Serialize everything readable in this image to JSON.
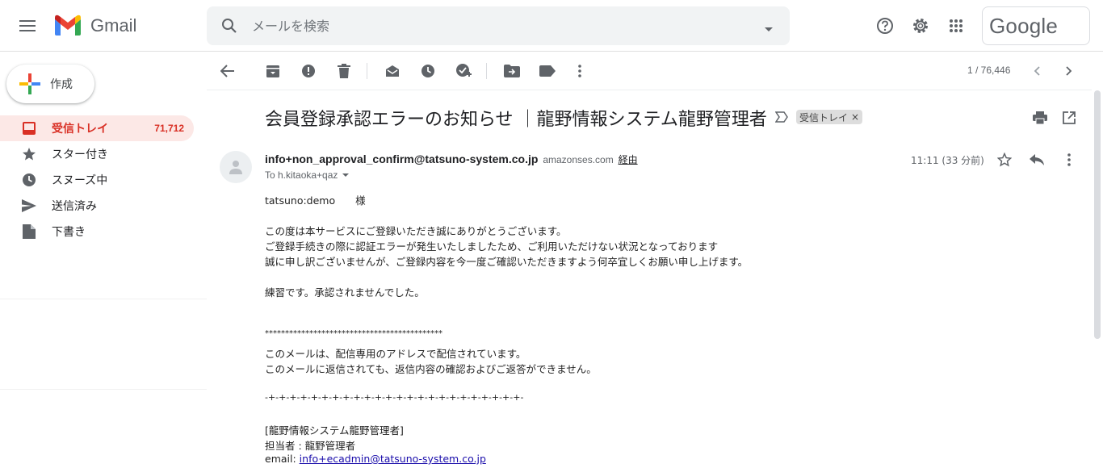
{
  "header": {
    "app_name": "Gmail",
    "search_placeholder": "メールを検索",
    "account_brand": "Google"
  },
  "sidebar": {
    "compose_label": "作成",
    "items": [
      {
        "label": "受信トレイ",
        "count": "71,712",
        "icon": "inbox-icon",
        "active": true
      },
      {
        "label": "スター付き",
        "count": "",
        "icon": "star-icon",
        "active": false
      },
      {
        "label": "スヌーズ中",
        "count": "",
        "icon": "clock-icon",
        "active": false
      },
      {
        "label": "送信済み",
        "count": "",
        "icon": "send-icon",
        "active": false
      },
      {
        "label": "下書き",
        "count": "",
        "icon": "draft-icon",
        "active": false
      }
    ]
  },
  "toolbar": {
    "pager": "1 / 76,446"
  },
  "message": {
    "subject": "会員登録承認エラーのお知らせ ｜龍野情報システム龍野管理者",
    "label_chip": "受信トレイ",
    "chip_close": "×",
    "sender_email": "info+non_approval_confirm@tatsuno-system.co.jp",
    "via_domain": "amazonses.com",
    "via_label": "経由",
    "to": "To h.kitaoka+qaz",
    "time": "11:11 (33 分前)",
    "body_lines": [
      "tatsuno:demo　　様",
      "この度は本サービスにご登録いただき誠にありがとうございます。",
      "ご登録手続きの際に認証エラーが発生いたしましたため、ご利用いただけない状況となっております",
      "誠に申し訳ございませんが、ご登録内容を今一度ご確認いただきますよう何卒宜しくお願い申し上げます。",
      "練習です。承認されませんでした。",
      "********************************************",
      "このメールは、配信専用のアドレスで配信されています。",
      "このメールに返信されても、返信内容の確認およびご返答ができません。",
      "-+-+-+-+-+-+-+-+-+-+-+-+-+-+-+-+-+-+-+-+-+-+-+-+-",
      "[龍野情報システム龍野管理者]",
      "担当者 : 龍野管理者",
      "email: "
    ],
    "contact_email": "info+ecadmin@tatsuno-system.co.jp"
  },
  "colors": {
    "accent_red": "#d93025",
    "active_bg": "#fce8e6",
    "link": "#1a0dab"
  }
}
